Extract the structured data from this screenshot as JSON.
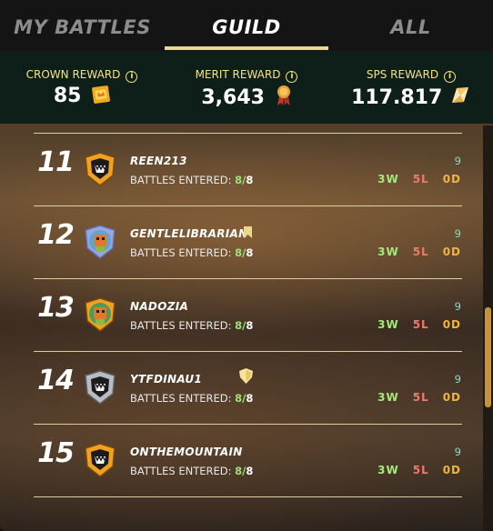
{
  "tabs": [
    {
      "label": "MY BATTLES",
      "active": false
    },
    {
      "label": "GUILD",
      "active": true
    },
    {
      "label": "ALL",
      "active": false
    }
  ],
  "rewards": [
    {
      "label": "CROWN REWARD",
      "value": "85",
      "icon": "crown-ticket-icon"
    },
    {
      "label": "MERIT REWARD",
      "value": "3,643",
      "icon": "merit-medal-icon"
    },
    {
      "label": "SPS REWARD",
      "value": "117.817",
      "icon": "sps-token-icon"
    }
  ],
  "players": [
    {
      "rank": "11",
      "name": "REEN213",
      "entered_label": "BATTLES ENTERED:",
      "entered": "8",
      "total": "8",
      "score": "9",
      "wins": "3W",
      "losses": "5L",
      "draws": "0D",
      "avatar": "orange-monster-avatar",
      "badge": null
    },
    {
      "rank": "12",
      "name": "GENTLELIBRARIAN",
      "entered_label": "BATTLES ENTERED:",
      "entered": "8",
      "total": "8",
      "score": "9",
      "wins": "3W",
      "losses": "5L",
      "draws": "0D",
      "avatar": "purple-goblin-avatar",
      "badge": "bookmark-icon"
    },
    {
      "rank": "13",
      "name": "NADOZIA",
      "entered_label": "BATTLES ENTERED:",
      "entered": "8",
      "total": "8",
      "score": "9",
      "wins": "3W",
      "losses": "5L",
      "draws": "0D",
      "avatar": "orange-goblin-avatar",
      "badge": null
    },
    {
      "rank": "14",
      "name": "YTFDINAU1",
      "entered_label": "BATTLES ENTERED:",
      "entered": "8",
      "total": "8",
      "score": "9",
      "wins": "3W",
      "losses": "5L",
      "draws": "0D",
      "avatar": "silver-monster-avatar",
      "badge": "shield-icon"
    },
    {
      "rank": "15",
      "name": "ONTHEMOUNTAIN",
      "entered_label": "BATTLES ENTERED:",
      "entered": "8",
      "total": "8",
      "score": "9",
      "wins": "3W",
      "losses": "5L",
      "draws": "0D",
      "avatar": "orange-monster-avatar",
      "badge": null
    }
  ],
  "colors": {
    "accent": "#e8d890",
    "reward_label": "#f2e28a",
    "win": "#a3ea7a",
    "loss": "#ec7b6c",
    "draw": "#f0b43c",
    "score": "#7ce0c8"
  }
}
